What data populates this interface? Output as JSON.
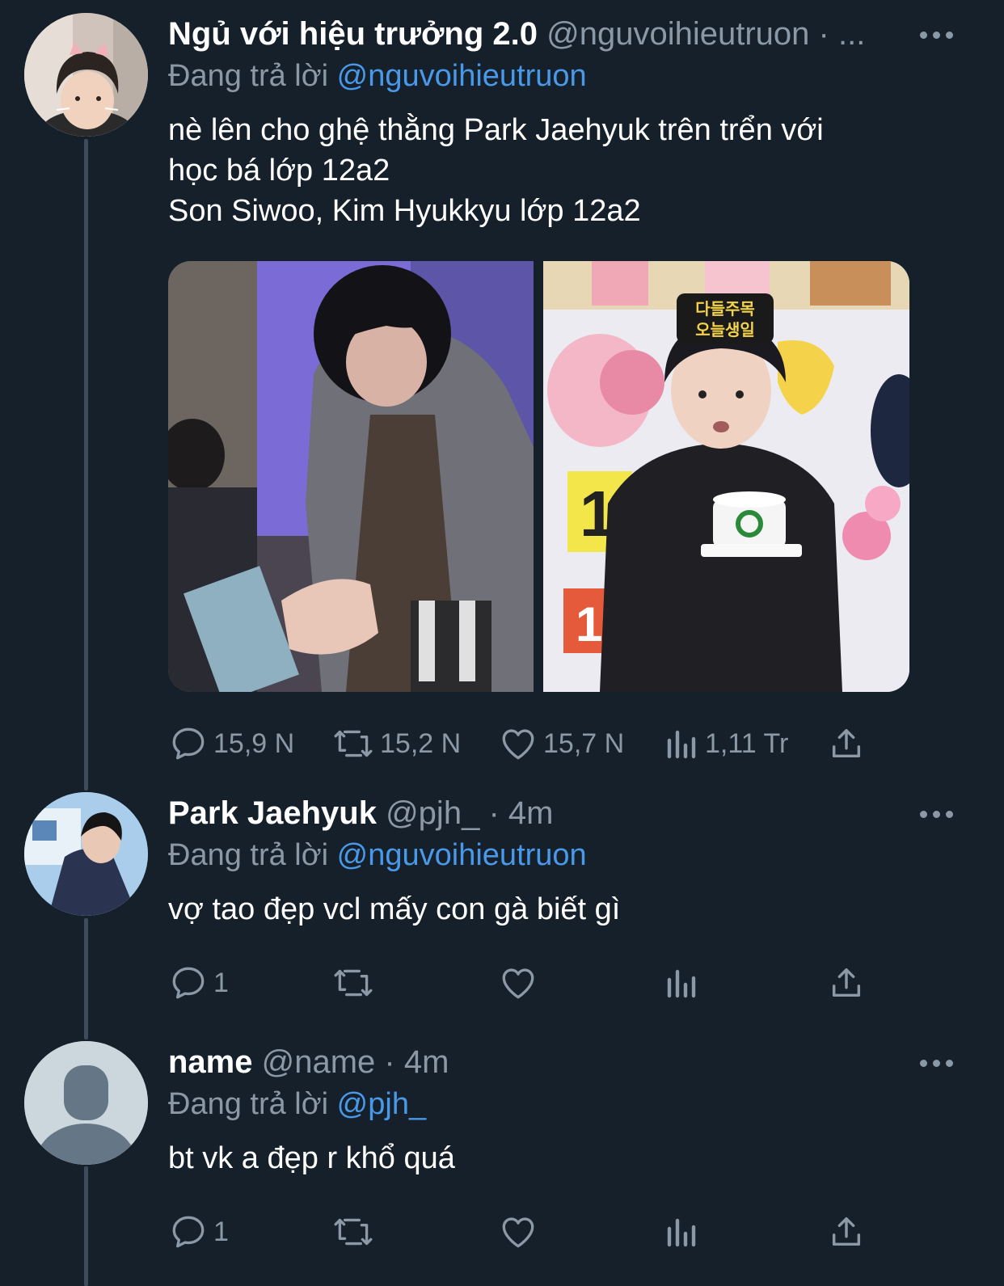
{
  "tweets": [
    {
      "display_name": "Ngủ với hiệu trưởng 2.0",
      "handle": "@nguvoihieutruon",
      "time": "· ...",
      "reply_prefix": "Đang trả lời",
      "reply_to": "@nguvoihieutruon",
      "text": "nè lên cho ghệ thằng Park Jaehyuk trên trển với\nhọc bá lớp 12a2\nSon Siwoo, Kim Hyukkyu lớp 12a2",
      "stats": {
        "replies": "15,9 N",
        "retweets": "15,2 N",
        "likes": "15,7 N",
        "views": "1,11 Tr"
      }
    },
    {
      "display_name": "Park Jaehyuk",
      "handle": "@pjh_",
      "time": "· 4m",
      "reply_prefix": "Đang trả lời",
      "reply_to": "@nguvoihieutruon",
      "text": "vợ tao đẹp vcl mấy con gà biết gì",
      "stats": {
        "replies": "1",
        "retweets": "",
        "likes": "",
        "views": ""
      }
    },
    {
      "display_name": "name",
      "handle": "@name",
      "time": "· 4m",
      "reply_prefix": "Đang trả lời",
      "reply_to": "@pjh_",
      "text": "bt vk a đẹp r khổ quá",
      "stats": {
        "replies": "1",
        "retweets": "",
        "likes": "",
        "views": ""
      }
    }
  ],
  "media_signs": {
    "sign_line1": "다들주목",
    "sign_line2": "오늘생일"
  },
  "icons": [
    "reply-icon",
    "retweet-icon",
    "like-icon",
    "views-icon",
    "share-icon",
    "more-icon"
  ],
  "colors": {
    "background": "#15202b",
    "muted": "#8b98a5",
    "link": "#4a99e9",
    "text": "#ffffff"
  }
}
